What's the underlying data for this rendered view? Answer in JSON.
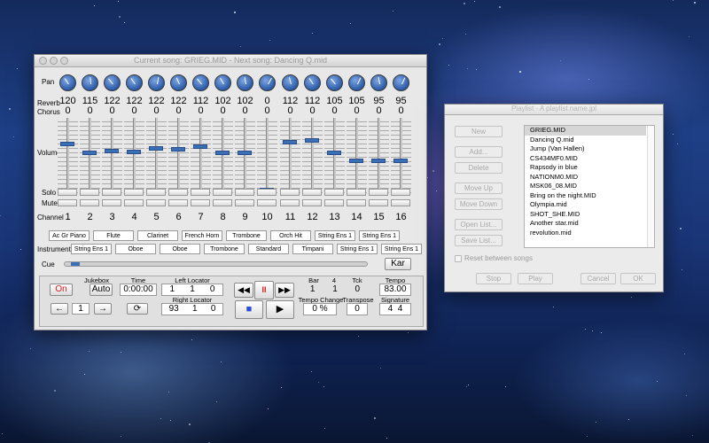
{
  "mixer": {
    "window_title": "Current song: GRIEG.MID - Next song: Dancing Q.mid",
    "labels": {
      "pan": "Pan",
      "reverb": "Reverb",
      "chorus": "Chorus",
      "volume": "Volume",
      "solo": "Solo",
      "mute": "Mute",
      "channel": "Channel",
      "instrument": "Instrument",
      "cue": "Cue"
    },
    "pan_angles": [
      -35,
      -5,
      -40,
      -35,
      10,
      -25,
      -40,
      -30,
      -10,
      30,
      -15,
      -35,
      -40,
      25,
      -10,
      25
    ],
    "reverb": [
      "120",
      "115",
      "122",
      "122",
      "122",
      "122",
      "112",
      "102",
      "102",
      "0",
      "112",
      "112",
      "105",
      "105",
      "95",
      "95"
    ],
    "chorus": [
      "0",
      "0",
      "0",
      "0",
      "0",
      "0",
      "0",
      "0",
      "0",
      "0",
      "0",
      "0",
      "0",
      "0",
      "0",
      "0"
    ],
    "volume": [
      0.68,
      0.55,
      0.58,
      0.57,
      0.62,
      0.6,
      0.64,
      0.55,
      0.55,
      0.05,
      0.7,
      0.72,
      0.55,
      0.45,
      0.45,
      0.45
    ],
    "channels": [
      "1",
      "2",
      "3",
      "4",
      "5",
      "6",
      "7",
      "8",
      "9",
      "10",
      "11",
      "12",
      "13",
      "14",
      "15",
      "16"
    ],
    "instruments_row1": [
      "Ac Gr Piano",
      "Flute",
      "Clarinet",
      "French Horn",
      "Trombone",
      "Orch Hit",
      "String Ens 1",
      "String Ens 1"
    ],
    "instruments_row2": [
      "String Ens 1",
      "Oboe",
      "Oboe",
      "Trombone",
      "Standard",
      "Timpani",
      "String Ens 1",
      "String Ens 1"
    ],
    "kar_label": "Kar",
    "cue_position": 0.02
  },
  "transport": {
    "jukebox_label": "Jukebox",
    "on_label": "On",
    "auto_label": "Auto",
    "prev_label": "←",
    "next_label": "→",
    "song_index": "1",
    "loop_icon": "⟳",
    "time_label": "Time",
    "time_value": "0:00:00",
    "left_locator_label": "Left Locator",
    "left_locator": [
      "1",
      "1",
      "0"
    ],
    "right_locator_label": "Right Locator",
    "right_locator": [
      "93",
      "1",
      "0"
    ],
    "rewind_icon": "◀◀",
    "pause_icon": "II",
    "ffwd_icon": "▶▶",
    "stop_icon": "■",
    "play_icon": "▶",
    "bar_label": "Bar",
    "beat_label": "4",
    "tck_label": "Tck",
    "position": [
      "1",
      "1",
      "0"
    ],
    "tempo_label": "Tempo",
    "tempo_value": "83.00",
    "tempo_change_label": "Tempo Change",
    "tempo_change_value": "0 %",
    "transpose_label": "Transpose",
    "transpose_value": "0",
    "signature_label": "Signature",
    "signature_value": "4  4"
  },
  "playlist": {
    "window_title": "Playlist - A playlist name.jpl",
    "buttons": {
      "new": "New",
      "add": "Add...",
      "delete": "Delete",
      "move_up": "Move Up",
      "move_down": "Move Down",
      "open_list": "Open List...",
      "save_list": "Save List...",
      "stop": "Stop",
      "play": "Play",
      "cancel": "Cancel",
      "ok": "OK"
    },
    "reset_label": "Reset between songs",
    "items": [
      "GRIEG.MID",
      "Dancing Q.mid",
      "Jump (Van Hallen)",
      "CS434MF0.MID",
      "Rapsody in blue",
      "NATIONM0.MID",
      "MSK06_08.MID",
      "Bring on the night.MID",
      "Olympia.mid",
      "SHOT_SHE.MID",
      "Another star.mid",
      "revolution.mid"
    ],
    "selected_index": 0
  },
  "colors": {
    "knob": "#2b5aa8",
    "fader_thumb": "#3a6fb8",
    "on_text": "#d81e1e",
    "stop_blue": "#2a4fd6",
    "pause_red": "#d81e1e"
  }
}
